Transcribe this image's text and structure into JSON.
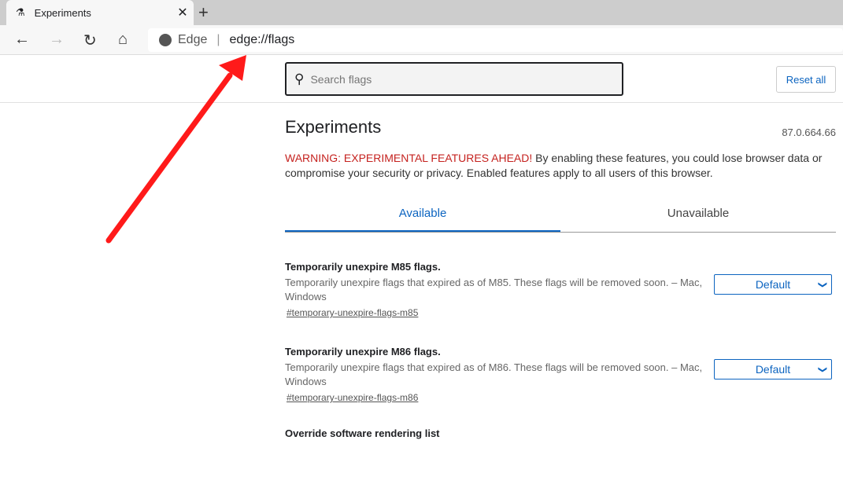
{
  "browser": {
    "tab_title": "Experiments",
    "tab_close": "✕",
    "new_tab": "+",
    "back": "←",
    "forward": "→",
    "reload": "↻",
    "home": "⌂",
    "site_label": "Edge",
    "url": "edge://flags"
  },
  "header": {
    "search_placeholder": "Search flags",
    "reset_label": "Reset all"
  },
  "main": {
    "title": "Experiments",
    "version": "87.0.664.66",
    "warning_red": "WARNING: EXPERIMENTAL FEATURES AHEAD!",
    "warning_text": " By enabling these features, you could lose browser data or compromise your security or privacy. Enabled features apply to all users of this browser.",
    "tabs": [
      {
        "label": "Available"
      },
      {
        "label": "Unavailable"
      }
    ],
    "flags": [
      {
        "title": "Temporarily unexpire M85 flags.",
        "desc": "Temporarily unexpire flags that expired as of M85. These flags will be removed soon. – Mac, Windows",
        "link": "#temporary-unexpire-flags-m85",
        "value": "Default"
      },
      {
        "title": "Temporarily unexpire M86 flags.",
        "desc": "Temporarily unexpire flags that expired as of M86. These flags will be removed soon. – Mac, Windows",
        "link": "#temporary-unexpire-flags-m86",
        "value": "Default"
      },
      {
        "title": "Override software rendering list"
      }
    ]
  },
  "colors": {
    "accent": "#0c64c0",
    "warning": "#c5221f",
    "annotation_arrow": "#ff1a1a"
  }
}
